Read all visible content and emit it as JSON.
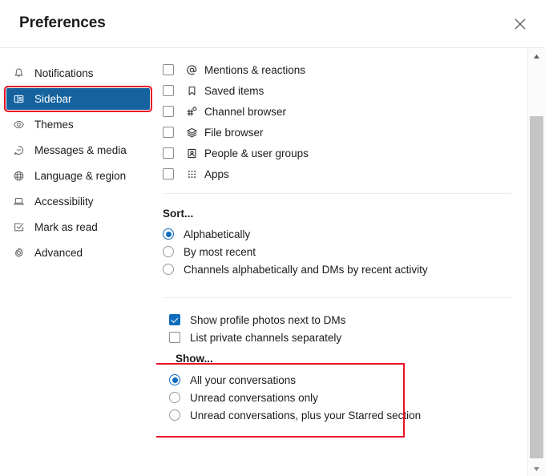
{
  "header": {
    "title": "Preferences",
    "close_label": "Close"
  },
  "sidebar": {
    "items": [
      {
        "label": "Notifications",
        "icon": "bell-icon",
        "selected": false,
        "highlighted": false
      },
      {
        "label": "Sidebar",
        "icon": "sidebar-panel-icon",
        "selected": true,
        "highlighted": true
      },
      {
        "label": "Themes",
        "icon": "eye-icon",
        "selected": false,
        "highlighted": false
      },
      {
        "label": "Messages & media",
        "icon": "speech-bubble-icon",
        "selected": false,
        "highlighted": false
      },
      {
        "label": "Language & region",
        "icon": "globe-icon",
        "selected": false,
        "highlighted": false
      },
      {
        "label": "Accessibility",
        "icon": "laptop-icon",
        "selected": false,
        "highlighted": false
      },
      {
        "label": "Mark as read",
        "icon": "check-square-icon",
        "selected": false,
        "highlighted": false
      },
      {
        "label": "Advanced",
        "icon": "gear-icon",
        "selected": false,
        "highlighted": false
      }
    ]
  },
  "main": {
    "shortcuts": [
      {
        "label": "Mentions & reactions",
        "icon": "at-mention-icon",
        "checked": false
      },
      {
        "label": "Saved items",
        "icon": "bookmark-icon",
        "checked": false
      },
      {
        "label": "Channel browser",
        "icon": "hash-search-icon",
        "checked": false
      },
      {
        "label": "File browser",
        "icon": "stacked-layers-icon",
        "checked": false
      },
      {
        "label": "People & user groups",
        "icon": "person-card-icon",
        "checked": false
      },
      {
        "label": "Apps",
        "icon": "grid-dots-icon",
        "checked": false
      }
    ],
    "sort": {
      "title": "Sort...",
      "options": [
        {
          "label": "Alphabetically",
          "selected": true
        },
        {
          "label": "By most recent",
          "selected": false
        },
        {
          "label": "Channels alphabetically and DMs by recent activity",
          "selected": false
        }
      ]
    },
    "toggles": [
      {
        "label": "Show profile photos next to DMs",
        "checked": true
      },
      {
        "label": "List private channels separately",
        "checked": false
      }
    ],
    "show": {
      "title": "Show...",
      "options": [
        {
          "label": "All your conversations",
          "selected": true
        },
        {
          "label": "Unread conversations only",
          "selected": false
        },
        {
          "label": "Unread conversations, plus your Starred section",
          "selected": false
        }
      ]
    }
  },
  "scrollbar": {
    "up_label": "Scroll up",
    "down_label": "Scroll down",
    "thumb_label": "Scroll thumb"
  },
  "annotations": {
    "accent_red": "#e81123",
    "accent_blue": "#0F6CBD",
    "selected_nav_blue": "#15629E"
  }
}
